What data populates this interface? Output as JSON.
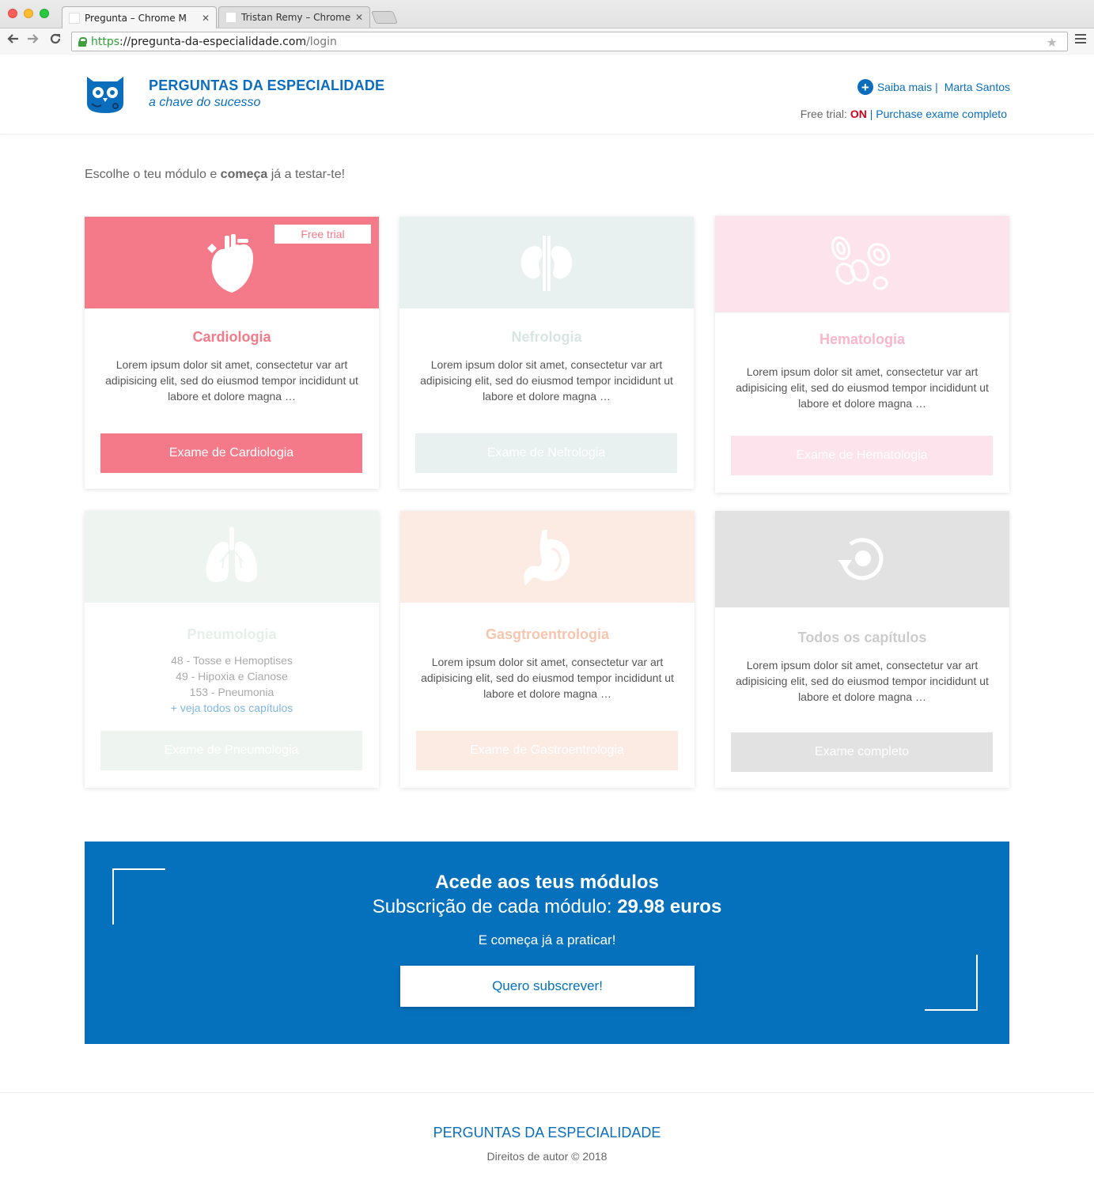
{
  "browser": {
    "tabs": [
      {
        "title": "Pregunta – Chrome M"
      },
      {
        "title": "Tristan Remy – Chrome M"
      }
    ],
    "url_https": "https",
    "url_host": "://pregunta-da-especialidade.com",
    "url_path": "/login"
  },
  "header": {
    "brand_title": "PERGUNTAS DA ESPECIALIDADE",
    "brand_sub": "a chave do sucesso",
    "saiba_mais": "Saiba mais",
    "separator": "|",
    "user_name": "Marta Santos",
    "trial_label": "Free trial:",
    "trial_status": "ON",
    "trial_sep": "|",
    "purchase_link": "Purchase exame completo"
  },
  "intro": {
    "before": "Escolhe o teu módulo e ",
    "bold": "começa",
    "after": " já a testar-te!"
  },
  "cards": [
    {
      "title": "Cardiologia",
      "description": "Lorem ipsum dolor sit amet, consectetur var art adipisicing elit, sed do eiusmod tempor incididunt ut labore et dolore magna …",
      "button": "Exame de Cardiologia",
      "badge": "Free trial",
      "icon": "heart-icon",
      "color": "#f47a8a",
      "state": "active"
    },
    {
      "title": "Nefrologia",
      "description": "Lorem ipsum dolor sit amet, consectetur var art adipisicing elit, sed do eiusmod tempor incididunt ut labore et dolore magna …",
      "button": "Exame de Nefrologia",
      "icon": "kidneys-icon",
      "color": "#e8f1ef",
      "state": "locked"
    },
    {
      "title": "Hematologia",
      "description": "Lorem ipsum dolor sit amet, consectetur var art adipisicing elit, sed do eiusmod tempor incididunt ut labore et dolore magna …",
      "button": "Exame de Hematologia",
      "icon": "blood-cells-icon",
      "color": "#fde3eb",
      "state": "locked"
    },
    {
      "title": "Pneumologia",
      "chapters": [
        "48 - Tosse e Hemoptises",
        "49 - Hipoxia e Cianose",
        "153 - Pneumonia"
      ],
      "more": "+ veja todos os capítulos",
      "button": "Exame de Pneumologia",
      "icon": "lungs-icon",
      "color": "#eef5f1",
      "state": "locked"
    },
    {
      "title": "Gasgtroentrologia",
      "description": "Lorem ipsum dolor sit amet, consectetur var art adipisicing elit, sed do eiusmod tempor incididunt ut labore et dolore magna …",
      "button": "Exame de Gastroentrologia",
      "icon": "stomach-icon",
      "color": "#fcebe3",
      "state": "locked"
    },
    {
      "title": "Todos os capítulos",
      "description": "Lorem ipsum dolor sit amet, consectetur var art adipisicing elit, sed do eiusmod tempor incididunt ut labore et dolore magna …",
      "button": "Exame completo",
      "icon": "cycle-icon",
      "color": "#e2e2e2",
      "state": "locked"
    }
  ],
  "promo": {
    "headline": "Acede aos teus módulos",
    "price_label": "Subscrição de cada módulo: ",
    "price_value": "29.98 euros",
    "tagline": "E começa já a praticar!",
    "button": "Quero subscrever!",
    "bg_color": "#0571bd"
  },
  "footer": {
    "title": "PERGUNTAS DA ESPECIALIDADE",
    "copyright": "Direitos de autor © 2018"
  },
  "colors": {
    "brand_blue": "#0a6ebd",
    "trial_on": "#d0021b"
  }
}
